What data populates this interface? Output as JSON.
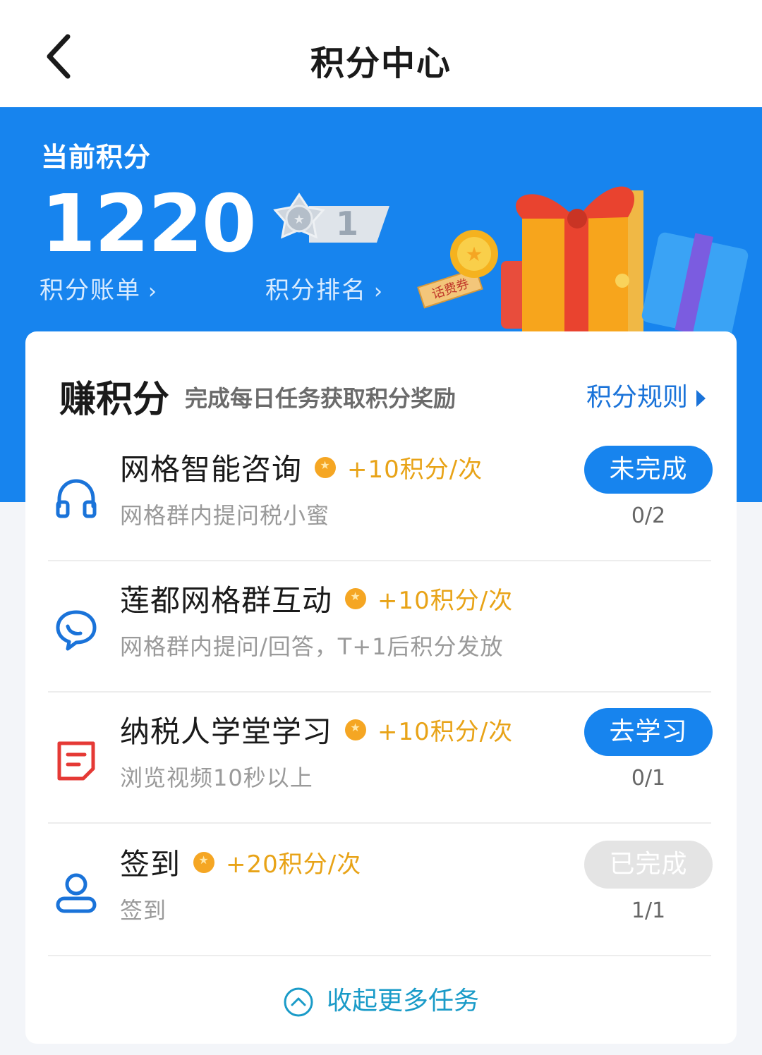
{
  "header": {
    "title": "积分中心"
  },
  "hero": {
    "points_label": "当前积分",
    "points_value": "1220",
    "rank_number": "1",
    "bill_link": "积分账单",
    "rank_link": "积分排名",
    "chevron": "›",
    "voucher_text": "话费券"
  },
  "earn": {
    "title": "赚积分",
    "subtitle": "完成每日任务获取积分奖励",
    "rules_link": "积分规则"
  },
  "tasks": [
    {
      "name": "网格智能咨询",
      "reward": "+10积分/次",
      "desc": "网格群内提问税小蜜",
      "button": "未完成",
      "progress": "0/2",
      "icon": "headphones-icon"
    },
    {
      "name": "莲都网格群互动",
      "reward": "+10积分/次",
      "desc": "网格群内提问/回答，T+1后积分发放",
      "button": "",
      "progress": "",
      "icon": "chat-bubble-icon"
    },
    {
      "name": "纳税人学堂学习",
      "reward": "+10积分/次",
      "desc": "浏览视频10秒以上",
      "button": "去学习",
      "progress": "0/1",
      "icon": "document-icon"
    },
    {
      "name": "签到",
      "reward": "+20积分/次",
      "desc": "签到",
      "button": "已完成",
      "progress": "1/1",
      "icon": "user-icon"
    }
  ],
  "footer": {
    "collapse_label": "收起更多任务"
  },
  "colors": {
    "primary": "#1784ee",
    "reward": "#e8a317",
    "done": "#e4e4e4",
    "document_icon": "#e53935"
  }
}
